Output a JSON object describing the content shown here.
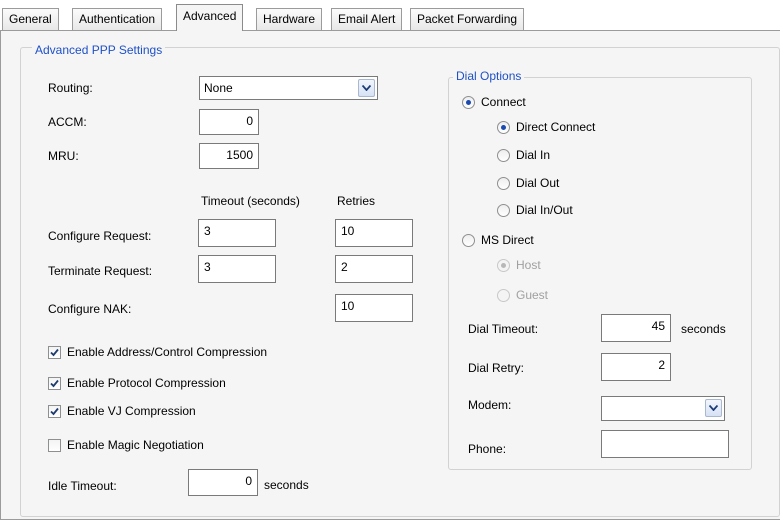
{
  "tabs": [
    {
      "label": "General"
    },
    {
      "label": "Authentication"
    },
    {
      "label": "Advanced"
    },
    {
      "label": "Hardware"
    },
    {
      "label": "Email Alert"
    },
    {
      "label": "Packet Forwarding"
    }
  ],
  "ppp": {
    "title": "Advanced PPP Settings",
    "routing_label": "Routing:",
    "routing_value": "None",
    "accm_label": "ACCM:",
    "accm_value": "0",
    "mru_label": "MRU:",
    "mru_value": "1500",
    "timeout_header": "Timeout (seconds)",
    "retries_header": "Retries",
    "configure_request_label": "Configure Request:",
    "configure_request_timeout": "3",
    "configure_request_retries": "10",
    "terminate_request_label": "Terminate Request:",
    "terminate_request_timeout": "3",
    "terminate_request_retries": "2",
    "configure_nak_label": "Configure NAK:",
    "configure_nak_retries": "10",
    "addr_ctrl_compression": "Enable Address/Control Compression",
    "protocol_compression": "Enable Protocol Compression",
    "vj_compression": "Enable VJ Compression",
    "magic_negotiation": "Enable Magic Negotiation",
    "idle_timeout_label": "Idle Timeout:",
    "idle_timeout_value": "0",
    "idle_timeout_unit": "seconds"
  },
  "dial": {
    "title": "Dial Options",
    "connect": "Connect",
    "direct_connect": "Direct Connect",
    "dial_in": "Dial In",
    "dial_out": "Dial Out",
    "dial_in_out": "Dial In/Out",
    "ms_direct": "MS Direct",
    "host": "Host",
    "guest": "Guest",
    "dial_timeout_label": "Dial Timeout:",
    "dial_timeout_value": "45",
    "dial_timeout_unit": "seconds",
    "dial_retry_label": "Dial Retry:",
    "dial_retry_value": "2",
    "modem_label": "Modem:",
    "modem_value": "",
    "phone_label": "Phone:",
    "phone_value": ""
  }
}
